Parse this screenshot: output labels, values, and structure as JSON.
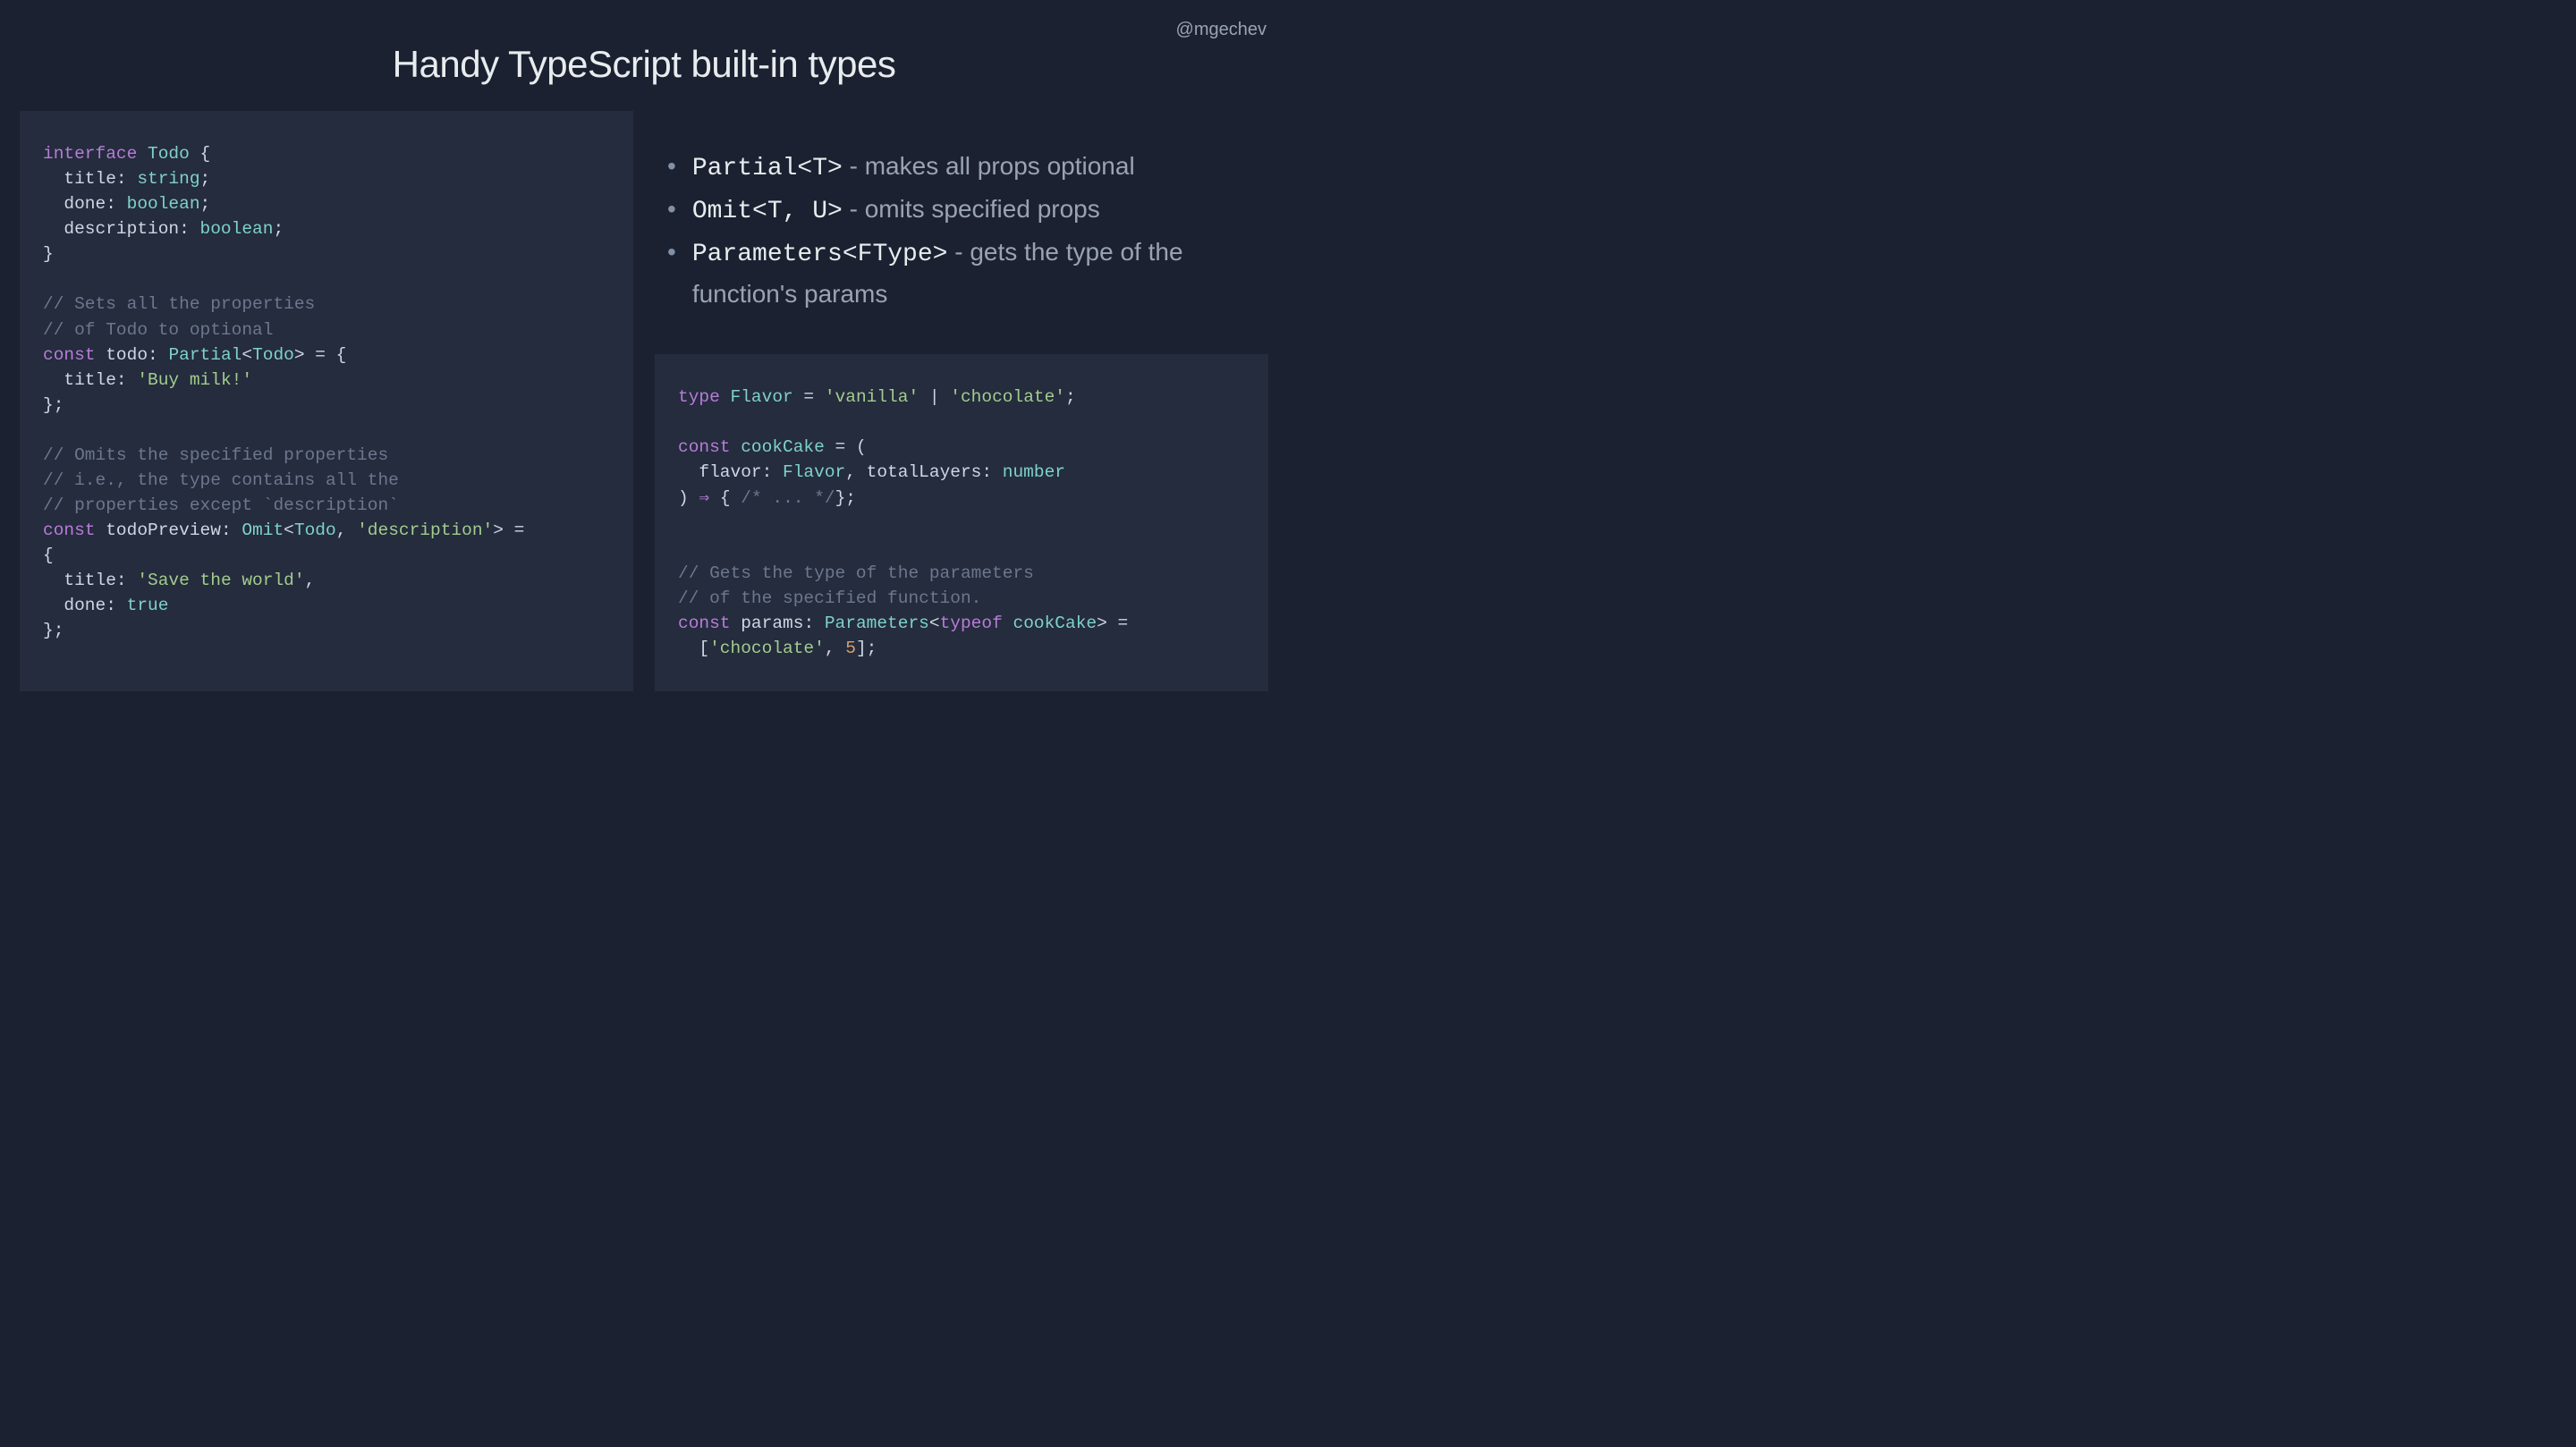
{
  "meta": {
    "handle": "@mgechev"
  },
  "title": "Handy TypeScript built-in types",
  "bullets": [
    {
      "code": "Partial<T>",
      "desc": " - makes all props optional"
    },
    {
      "code": "Omit<T, U>",
      "desc": " - omits specified props"
    },
    {
      "code": "Parameters<FType>",
      "desc": " - gets the type of the function's params"
    }
  ],
  "codeLeft": [
    [
      {
        "c": "kw",
        "t": "interface"
      },
      {
        "c": "pun",
        "t": " "
      },
      {
        "c": "ty",
        "t": "Todo"
      },
      {
        "c": "pun",
        "t": " {"
      }
    ],
    [
      {
        "c": "pun",
        "t": "  title: "
      },
      {
        "c": "ty",
        "t": "string"
      },
      {
        "c": "pun",
        "t": ";"
      }
    ],
    [
      {
        "c": "pun",
        "t": "  done: "
      },
      {
        "c": "ty",
        "t": "boolean"
      },
      {
        "c": "pun",
        "t": ";"
      }
    ],
    [
      {
        "c": "pun",
        "t": "  description: "
      },
      {
        "c": "ty",
        "t": "boolean"
      },
      {
        "c": "pun",
        "t": ";"
      }
    ],
    [
      {
        "c": "pun",
        "t": "}"
      }
    ],
    [
      {
        "c": "pun",
        "t": ""
      }
    ],
    [
      {
        "c": "com",
        "t": "// Sets all the properties"
      }
    ],
    [
      {
        "c": "com",
        "t": "// of Todo to optional"
      }
    ],
    [
      {
        "c": "kw",
        "t": "const"
      },
      {
        "c": "pun",
        "t": " "
      },
      {
        "c": "id",
        "t": "todo"
      },
      {
        "c": "pun",
        "t": ": "
      },
      {
        "c": "ty",
        "t": "Partial"
      },
      {
        "c": "pun",
        "t": "<"
      },
      {
        "c": "ty",
        "t": "Todo"
      },
      {
        "c": "pun",
        "t": "> = {"
      }
    ],
    [
      {
        "c": "pun",
        "t": "  title: "
      },
      {
        "c": "str",
        "t": "'Buy milk!'"
      }
    ],
    [
      {
        "c": "pun",
        "t": "};"
      }
    ],
    [
      {
        "c": "pun",
        "t": ""
      }
    ],
    [
      {
        "c": "com",
        "t": "// Omits the specified properties"
      }
    ],
    [
      {
        "c": "com",
        "t": "// i.e., the type contains all the"
      }
    ],
    [
      {
        "c": "com",
        "t": "// properties except `description`"
      }
    ],
    [
      {
        "c": "kw",
        "t": "const"
      },
      {
        "c": "pun",
        "t": " "
      },
      {
        "c": "id",
        "t": "todoPreview"
      },
      {
        "c": "pun",
        "t": ": "
      },
      {
        "c": "ty",
        "t": "Omit"
      },
      {
        "c": "pun",
        "t": "<"
      },
      {
        "c": "ty",
        "t": "Todo"
      },
      {
        "c": "pun",
        "t": ", "
      },
      {
        "c": "str",
        "t": "'description'"
      },
      {
        "c": "pun",
        "t": "> ="
      }
    ],
    [
      {
        "c": "pun",
        "t": "{"
      }
    ],
    [
      {
        "c": "pun",
        "t": "  title: "
      },
      {
        "c": "str",
        "t": "'Save the world'"
      },
      {
        "c": "pun",
        "t": ","
      }
    ],
    [
      {
        "c": "pun",
        "t": "  done: "
      },
      {
        "c": "boo",
        "t": "true"
      }
    ],
    [
      {
        "c": "pun",
        "t": "};"
      }
    ]
  ],
  "codeRight": [
    [
      {
        "c": "kw",
        "t": "type"
      },
      {
        "c": "pun",
        "t": " "
      },
      {
        "c": "ty",
        "t": "Flavor"
      },
      {
        "c": "pun",
        "t": " = "
      },
      {
        "c": "str",
        "t": "'vanilla'"
      },
      {
        "c": "pun",
        "t": " | "
      },
      {
        "c": "str",
        "t": "'chocolate'"
      },
      {
        "c": "pun",
        "t": ";"
      }
    ],
    [
      {
        "c": "pun",
        "t": ""
      }
    ],
    [
      {
        "c": "kw",
        "t": "const"
      },
      {
        "c": "pun",
        "t": " "
      },
      {
        "c": "fn",
        "t": "cookCake"
      },
      {
        "c": "pun",
        "t": " = ("
      }
    ],
    [
      {
        "c": "pun",
        "t": "  flavor: "
      },
      {
        "c": "ty",
        "t": "Flavor"
      },
      {
        "c": "pun",
        "t": ", totalLayers: "
      },
      {
        "c": "ty",
        "t": "number"
      }
    ],
    [
      {
        "c": "pun",
        "t": ") "
      },
      {
        "c": "kw",
        "t": "⇒"
      },
      {
        "c": "pun",
        "t": " { "
      },
      {
        "c": "com",
        "t": "/* ... */"
      },
      {
        "c": "pun",
        "t": "};"
      }
    ],
    [
      {
        "c": "pun",
        "t": ""
      }
    ],
    [
      {
        "c": "pun",
        "t": ""
      }
    ],
    [
      {
        "c": "com",
        "t": "// Gets the type of the parameters"
      }
    ],
    [
      {
        "c": "com",
        "t": "// of the specified function."
      }
    ],
    [
      {
        "c": "kw",
        "t": "const"
      },
      {
        "c": "pun",
        "t": " "
      },
      {
        "c": "id",
        "t": "params"
      },
      {
        "c": "pun",
        "t": ": "
      },
      {
        "c": "ty",
        "t": "Parameters"
      },
      {
        "c": "pun",
        "t": "<"
      },
      {
        "c": "kw",
        "t": "typeof"
      },
      {
        "c": "pun",
        "t": " "
      },
      {
        "c": "fn",
        "t": "cookCake"
      },
      {
        "c": "pun",
        "t": "> ="
      }
    ],
    [
      {
        "c": "pun",
        "t": "  ["
      },
      {
        "c": "str",
        "t": "'chocolate'"
      },
      {
        "c": "pun",
        "t": ", "
      },
      {
        "c": "num",
        "t": "5"
      },
      {
        "c": "pun",
        "t": "];"
      }
    ]
  ]
}
